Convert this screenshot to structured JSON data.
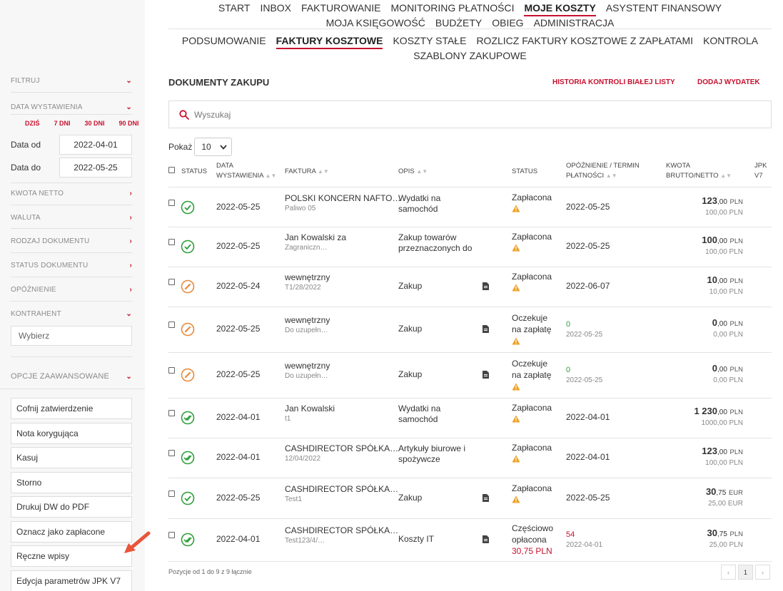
{
  "nav": {
    "main": [
      "START",
      "INBOX",
      "FAKTUROWANIE",
      "MONITORING PŁATNOŚCI",
      "MOJE KOSZTY",
      "ASYSTENT FINANSOWY",
      "MOJA KSIĘGOWOŚĆ",
      "BUDŻETY",
      "OBIEG",
      "ADMINISTRACJA"
    ],
    "sub": [
      "PODSUMOWANIE",
      "FAKTURY KOSZTOWE",
      "KOSZTY STAŁE",
      "ROZLICZ FAKTURY KOSZTOWE Z ZAPŁATAMI",
      "KONTROLA",
      "SZABLONY ZAKUPOWE"
    ]
  },
  "sidebar": {
    "filter_label": "FILTRUJ",
    "date_section": "DATA WYSTAWIENIA",
    "quick": [
      "DZIŚ",
      "7 DNI",
      "30 DNI",
      "90 DNI"
    ],
    "date_from_label": "Data od",
    "date_from": "2022-04-01",
    "date_to_label": "Data do",
    "date_to": "2022-05-25",
    "sections": [
      "KWOTA NETTO",
      "WALUTA",
      "RODZAJ DOKUMENTU",
      "STATUS DOKUMENTU",
      "OPÓŹNIENIE",
      "KONTRAHENT"
    ],
    "contractor_placeholder": "Wybierz",
    "advanced_label": "OPCJE ZAAWANSOWANE",
    "advanced_buttons": [
      "Cofnij zatwierdzenie",
      "Nota korygująca",
      "Kasuj",
      "Storno",
      "Drukuj DW do PDF",
      "Oznacz jako zapłacone",
      "Ręczne wpisy",
      "Edycja parametrów JPK V7"
    ]
  },
  "main": {
    "title": "DOKUMENTY ZAKUPU",
    "history_link": "HISTORIA KONTROLI BIAŁEJ LISTY",
    "add_link": "DODAJ WYDATEK",
    "search_placeholder": "Wyszukaj",
    "show_label": "Pokaż",
    "show_value": "10",
    "footer": "Pozycje od 1 do 9 z 9 łącznie",
    "page": "1"
  },
  "table": {
    "headers": {
      "status": "STATUS",
      "date_l1": "DATA",
      "date_l2": "WYSTAWIENIA",
      "invoice": "FAKTURA",
      "desc": "OPIS",
      "pay_status": "STATUS",
      "delay_l1": "OPÓŹNIENIE / TERMIN",
      "delay_l2": "PŁATNOŚCI",
      "amount_l1": "KWOTA",
      "amount_l2": "BRUTTO/NETTO",
      "jpk_l1": "JPK",
      "jpk_l2": "V7"
    },
    "rows": [
      {
        "status_icon": "check-icon",
        "date": "2022-05-25",
        "invoice": "POLSKI KONCERN NAFTO…",
        "invoice_sub": "Paliwo 05",
        "desc_l1": "Wydatki na",
        "desc_l2": "samochód",
        "doc": false,
        "pay_l1": "Zapłacona",
        "pay_l2": "",
        "pay_amount": "",
        "delay": "",
        "term": "2022-05-25",
        "gross_int": "123",
        "gross_dec": ",00",
        "currency": "PLN",
        "net": "100,00 PLN"
      },
      {
        "status_icon": "check-icon",
        "date": "2022-05-25",
        "invoice": "Jan Kowalski za",
        "invoice_sub": "Zagraniczn…",
        "desc_l1": "Zakup towarów",
        "desc_l2": "przeznaczonych do",
        "doc": false,
        "pay_l1": "Zapłacona",
        "pay_l2": "",
        "pay_amount": "",
        "delay": "",
        "term": "2022-05-25",
        "gross_int": "100",
        "gross_dec": ",00",
        "currency": "PLN",
        "net": "100,00 PLN"
      },
      {
        "status_icon": "pencil-icon",
        "date": "2022-05-24",
        "invoice": "wewnętrzny",
        "invoice_sub": "T1/28/2022",
        "desc_l1": "Zakup",
        "desc_l2": "",
        "doc": true,
        "pay_l1": "Zapłacona",
        "pay_l2": "",
        "pay_amount": "",
        "delay": "",
        "term": "2022-06-07",
        "gross_int": "10",
        "gross_dec": ",00",
        "currency": "PLN",
        "net": "10,00 PLN"
      },
      {
        "status_icon": "pencil-icon",
        "date": "2022-05-25",
        "invoice": "wewnętrzny",
        "invoice_sub": "Do uzupełn…",
        "desc_l1": "Zakup",
        "desc_l2": "",
        "doc": true,
        "pay_l1": "Oczekuje",
        "pay_l2": "na zapłatę",
        "pay_amount": "",
        "delay": "0",
        "term": "2022-05-25",
        "gross_int": "0",
        "gross_dec": ",00",
        "currency": "PLN",
        "net": "0,00 PLN"
      },
      {
        "status_icon": "pencil-icon",
        "date": "2022-05-25",
        "invoice": "wewnętrzny",
        "invoice_sub": "Do uzupełn…",
        "desc_l1": "Zakup",
        "desc_l2": "",
        "doc": true,
        "pay_l1": "Oczekuje",
        "pay_l2": "na zapłatę",
        "pay_amount": "",
        "delay": "0",
        "term": "2022-05-25",
        "gross_int": "0",
        "gross_dec": ",00",
        "currency": "PLN",
        "net": "0,00 PLN"
      },
      {
        "status_icon": "double-check-icon",
        "date": "2022-04-01",
        "invoice": "Jan Kowalski",
        "invoice_sub": "t1",
        "desc_l1": "Wydatki na",
        "desc_l2": "samochód",
        "doc": false,
        "pay_l1": "Zapłacona",
        "pay_l2": "",
        "pay_amount": "",
        "delay": "",
        "term": "2022-04-01",
        "gross_int": "1 230",
        "gross_dec": ",00",
        "currency": "PLN",
        "net": "1000,00 PLN"
      },
      {
        "status_icon": "double-check-icon",
        "date": "2022-04-01",
        "invoice": "CASHDIRECTOR SPÓŁKA…",
        "invoice_sub": "12/04/2022",
        "desc_l1": "Artykuły biurowe i",
        "desc_l2": "spożywcze",
        "doc": false,
        "pay_l1": "Zapłacona",
        "pay_l2": "",
        "pay_amount": "",
        "delay": "",
        "term": "2022-04-01",
        "gross_int": "123",
        "gross_dec": ",00",
        "currency": "PLN",
        "net": "100,00 PLN"
      },
      {
        "status_icon": "check-icon",
        "date": "2022-05-25",
        "invoice": "CASHDIRECTOR SPÓŁKA…",
        "invoice_sub": "Test1",
        "desc_l1": "Zakup",
        "desc_l2": "",
        "doc": true,
        "pay_l1": "Zapłacona",
        "pay_l2": "",
        "pay_amount": "",
        "delay": "",
        "term": "2022-05-25",
        "gross_int": "30",
        "gross_dec": ",75",
        "currency": "EUR",
        "net": "25,00 EUR"
      },
      {
        "status_icon": "double-check-icon",
        "date": "2022-04-01",
        "invoice": "CASHDIRECTOR SPÓŁKA…",
        "invoice_sub": "Test123/4/…",
        "desc_l1": "Koszty IT",
        "desc_l2": "",
        "doc": true,
        "pay_l1": "Częściowo",
        "pay_l2": "opłacona",
        "pay_amount": "30,75 PLN",
        "delay": "54",
        "term": "2022-04-01",
        "gross_int": "30",
        "gross_dec": ",75",
        "currency": "PLN",
        "net": "25,00 PLN"
      }
    ]
  },
  "colors": {
    "accent": "#c8102e",
    "ok": "#2e9e3a",
    "pending": "#e8893a",
    "warn": "#f0a020"
  }
}
